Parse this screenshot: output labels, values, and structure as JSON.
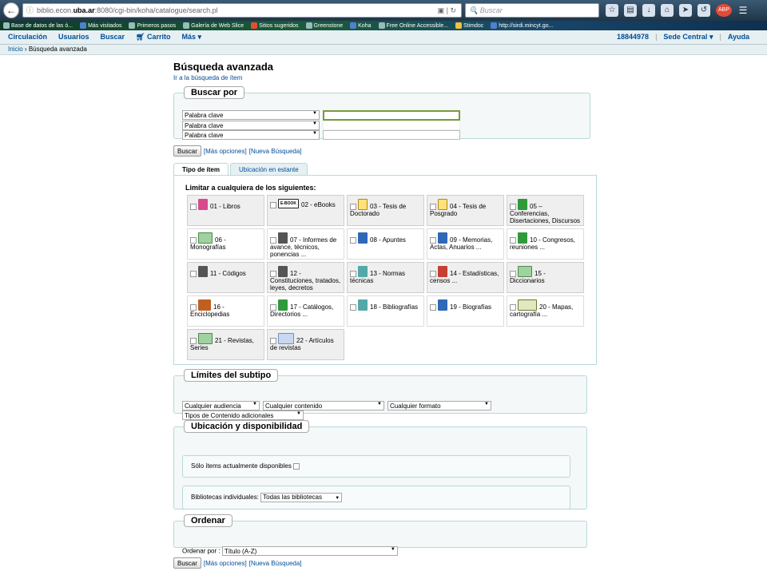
{
  "browser": {
    "url_host_prefix": "biblio.econ.",
    "url_host_bold": "uba.ar",
    "url_path": ":8080/cgi-bin/koha/catalogue/search.pl",
    "search_placeholder": "Buscar",
    "bookmarks": [
      "Base de datos de las ó...",
      "Más visitados",
      "Primeros pasos",
      "Galería de Web Slice",
      "Sitios sugeridos",
      "Greenstone",
      "Koha",
      "Free Online Accessible...",
      "Stimdoc",
      "http://sirdi.mincyt.go..."
    ],
    "abp_label": "ABP"
  },
  "koha_nav": {
    "items": [
      "Circulación",
      "Usuarios",
      "Buscar",
      "Carrito",
      "Más"
    ],
    "user": "18844978",
    "branch": "Sede Central",
    "help": "Ayuda"
  },
  "breadcrumb": {
    "home": "Inicio",
    "current": "Búsqueda avanzada"
  },
  "page": {
    "title": "Búsqueda avanzada",
    "switch_link": "Ir a la búsqueda de ítem"
  },
  "search_by": {
    "legend": "Buscar por",
    "rows": [
      {
        "field": "Palabra clave",
        "value": ""
      },
      {
        "field": "Palabra clave",
        "value": ""
      },
      {
        "field": "Palabra clave",
        "value": ""
      }
    ]
  },
  "actions": {
    "search_label": "Buscar",
    "more_options": "[Más opciones]",
    "new_search": "[Nueva Búsqueda]"
  },
  "tabs": [
    {
      "label": "Tipo de ítem",
      "active": true
    },
    {
      "label": "Ubicación en estante",
      "active": false
    }
  ],
  "item_types": {
    "heading": "Limitar a cualquiera de los siguientes:",
    "items": [
      {
        "label": "01 - Libros",
        "icon": "pink-book-icon",
        "shade": true
      },
      {
        "label": "02 - eBooks",
        "icon": "ebook-icon",
        "shade": true
      },
      {
        "label": "03 - Tesis de Doctorado",
        "icon": "thesis-icon",
        "shade": true
      },
      {
        "label": "04 - Tesis de Posgrado",
        "icon": "thesis-icon",
        "shade": true
      },
      {
        "label": "05 – Conferencias, Disertaciones, Discursos",
        "icon": "conference-icon",
        "shade": true
      },
      {
        "label": "06 - Monografías",
        "icon": "monograph-icon",
        "shade": false
      },
      {
        "label": "07 - Informes de avance, técnicos, ponencias ...",
        "icon": "report-icon",
        "shade": false
      },
      {
        "label": "08 - Apuntes",
        "icon": "notes-icon",
        "shade": false
      },
      {
        "label": "09 - Memorias, Actas, Anuarios ...",
        "icon": "memories-icon",
        "shade": false
      },
      {
        "label": "10 - Congresos, reuniones ...",
        "icon": "congress-icon",
        "shade": false
      },
      {
        "label": "11 - Códigos",
        "icon": "codes-icon",
        "shade": true
      },
      {
        "label": "12 - Constituciones, tratados, leyes, decretos",
        "icon": "laws-icon",
        "shade": true
      },
      {
        "label": "13 - Normas técnicas",
        "icon": "standards-icon",
        "shade": true
      },
      {
        "label": "14 - Estadísticas, censos ...",
        "icon": "statistics-icon",
        "shade": true
      },
      {
        "label": "15 - Diccionarios",
        "icon": "dictionary-icon",
        "shade": true
      },
      {
        "label": "16 - Enciclopedias",
        "icon": "encyclopedia-icon",
        "shade": false
      },
      {
        "label": "17 - Catálogos, Directorios ...",
        "icon": "catalog-icon",
        "shade": false
      },
      {
        "label": "18 - Bibliografías",
        "icon": "bibliography-icon",
        "shade": false
      },
      {
        "label": "19 - Biografías",
        "icon": "biography-icon",
        "shade": false
      },
      {
        "label": "20 - Mapas, cartografía ...",
        "icon": "map-icon",
        "shade": false
      },
      {
        "label": "21 - Revistas, Series",
        "icon": "journal-icon",
        "shade": true
      },
      {
        "label": "22 - Artículos de revistas",
        "icon": "article-icon",
        "shade": true
      }
    ]
  },
  "subtype": {
    "legend": "Límites del subtipo",
    "audience": "Cualquier audiencia",
    "content": "Cualquier contenido",
    "format": "Cualquier formato",
    "extra": "Tipos de Contenido adicionales"
  },
  "availability": {
    "legend": "Ubicación y disponibilidad",
    "only_available": "Sólo ítems actualmente disponibles",
    "libraries_label": "Bibliotecas individuales:",
    "libraries_value": "Todas las bibliotecas"
  },
  "sort": {
    "legend": "Ordenar",
    "label": "Ordenar por :",
    "value": "Título (A-Z)"
  },
  "colors": {
    "link": "#004d99",
    "nav_bg": "#e6f0f2",
    "box_border": "#b9d8d9"
  }
}
